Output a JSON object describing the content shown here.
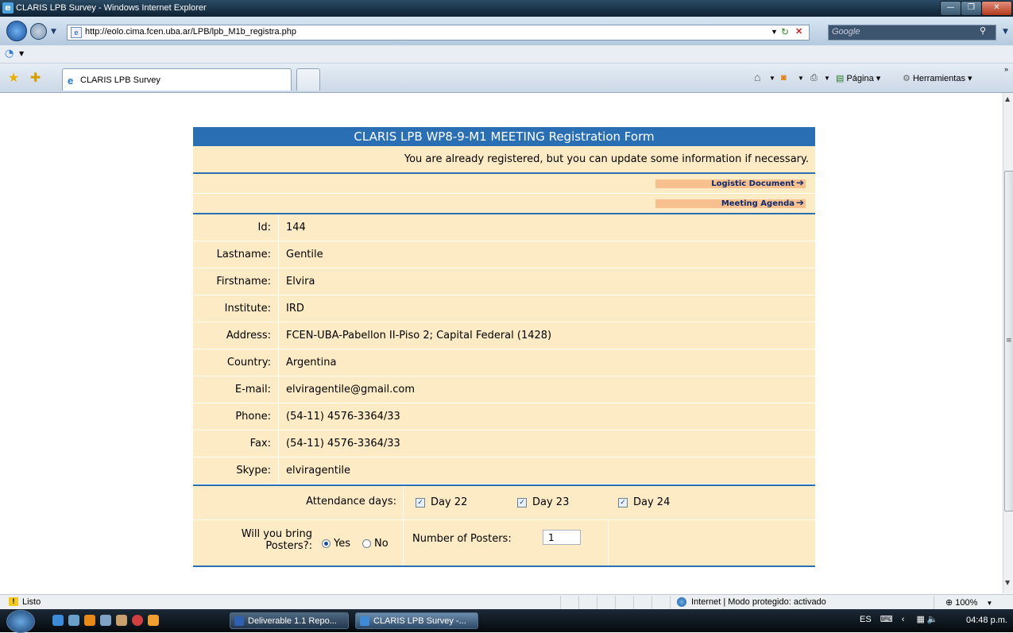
{
  "window": {
    "title": "CLARIS LPB Survey - Windows Internet Explorer"
  },
  "browser": {
    "url": "http://eolo.cima.fcen.uba.ar/LPB/lpb_M1b_registra.php",
    "search_placeholder": "Google",
    "tab_title": "CLARIS LPB Survey",
    "page_menu": "Página ▾",
    "tools_menu": "Herramientas ▾"
  },
  "form": {
    "header": "CLARIS LPB WP8-9-M1 MEETING Registration Form",
    "notice": "You are already registered, but you can update some information if necessary.",
    "links": [
      {
        "label": "Logistic Document"
      },
      {
        "label": "Meeting Agenda"
      }
    ],
    "fields": [
      {
        "label": "Id:",
        "value": "144"
      },
      {
        "label": "Lastname:",
        "value": "Gentile"
      },
      {
        "label": "Firstname:",
        "value": "Elvira"
      },
      {
        "label": "Institute:",
        "value": "IRD"
      },
      {
        "label": "Address:",
        "value": "FCEN-UBA-Pabellon II-Piso 2; Capital Federal (1428)"
      },
      {
        "label": "Country:",
        "value": "Argentina"
      },
      {
        "label": "E-mail:",
        "value": "elviragentile@gmail.com"
      },
      {
        "label": "Phone:",
        "value": "(54-11) 4576-3364/33"
      },
      {
        "label": "Fax:",
        "value": "(54-11) 4576-3364/33"
      },
      {
        "label": "Skype:",
        "value": "elviragentile"
      }
    ],
    "attendance": {
      "label": "Attendance days:",
      "days": [
        {
          "label": "Day 22",
          "checked": true
        },
        {
          "label": "Day 23",
          "checked": true
        },
        {
          "label": "Day 24",
          "checked": true
        }
      ]
    },
    "posters": {
      "question": "Will you bring Posters?:",
      "yes": "Yes",
      "no": "No",
      "selected": "Yes",
      "number_label": "Number of Posters:",
      "number_value": "1"
    }
  },
  "statusbar": {
    "status": "Listo",
    "zone": "Internet | Modo protegido: activado",
    "zoom": "100%"
  },
  "taskbar": {
    "items": [
      {
        "label": "Deliverable 1.1 Repo..."
      },
      {
        "label": "CLARIS LPB Survey -..."
      }
    ],
    "lang": "ES",
    "time": "04:48 p.m."
  },
  "colors": {
    "form_header": "#2a6fb3",
    "form_bg": "#fcebc4",
    "link_button": "#f8c08e"
  }
}
